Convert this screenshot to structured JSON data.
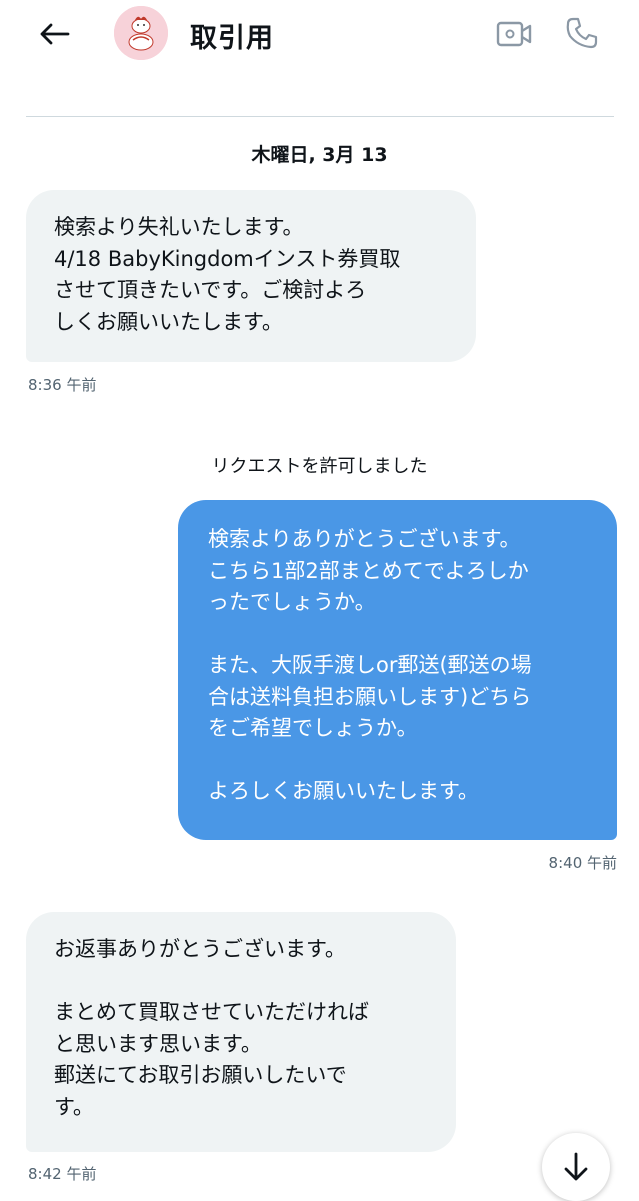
{
  "header": {
    "title": "取引用",
    "back_icon": "arrow-left-icon",
    "video_icon": "video-call-icon",
    "call_icon": "phone-icon"
  },
  "conversation": {
    "date_label": "木曜日, 3月 13",
    "system_message": "リクエストを許可しました",
    "messages": [
      {
        "direction": "incoming",
        "text": "検索より失礼いたします。\n4/18 BabyKingdomインスト券買取\nさせて頂きたいです。ご検討よろ\nしくお願いいたします。",
        "time": "8:36 午前"
      },
      {
        "direction": "outgoing",
        "text": "検索よりありがとうございます。\nこちら1部2部まとめてでよろしか\nったでしょうか。\n\nまた、大阪手渡しor郵送(郵送の場\n合は送料負担お願いします)どちら\nをご希望でしょうか。\n\nよろしくお願いいたします。",
        "time": "8:40 午前"
      },
      {
        "direction": "incoming",
        "text": "お返事ありがとうございます。\n\nまとめて買取させていただければ\nと思います思います。\n郵送にてお取引お願いしたいで\nす。",
        "time": "8:42 午前"
      }
    ]
  },
  "scroll_button": {
    "icon": "arrow-down-icon"
  },
  "colors": {
    "outgoing_bubble": "#4a97e6",
    "incoming_bubble": "#eff3f4",
    "timestamp": "#536471",
    "divider": "#cfd9de"
  }
}
